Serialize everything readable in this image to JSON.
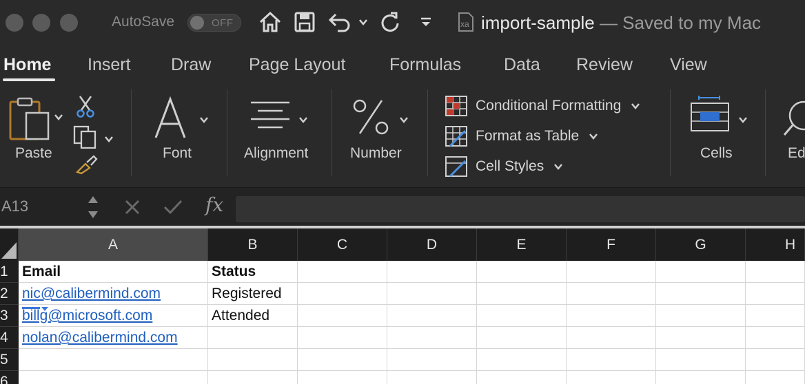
{
  "titlebar": {
    "autosave_label": "AutoSave",
    "autosave_state": "OFF",
    "doc_name": "import-sample",
    "doc_separator": " — ",
    "doc_status": "Saved to my Mac"
  },
  "tabs": [
    {
      "label": "Home",
      "active": true
    },
    {
      "label": "Insert"
    },
    {
      "label": "Draw"
    },
    {
      "label": "Page Layout"
    },
    {
      "label": "Formulas"
    },
    {
      "label": "Data"
    },
    {
      "label": "Review"
    },
    {
      "label": "View"
    }
  ],
  "ribbon": {
    "paste": "Paste",
    "font": "Font",
    "alignment": "Alignment",
    "number": "Number",
    "conditional_formatting": "Conditional Formatting",
    "format_as_table": "Format as Table",
    "cell_styles": "Cell Styles",
    "cells": "Cells",
    "editing": "Ed"
  },
  "formula_bar": {
    "name_box": "A13",
    "fx": "fx",
    "value": ""
  },
  "grid": {
    "columns": [
      "A",
      "B",
      "C",
      "D",
      "E",
      "F",
      "G",
      "H"
    ],
    "selected_column": "A",
    "rows": [
      {
        "num": "1",
        "a": "Email",
        "b": "Status"
      },
      {
        "num": "2",
        "a": "nic@calibermind.com",
        "b": "Registered"
      },
      {
        "num": "3",
        "a": "billg@microsoft.com",
        "b": "Attended"
      },
      {
        "num": "4",
        "a": "nolan@calibermind.com",
        "b": ""
      },
      {
        "num": "5",
        "a": "",
        "b": ""
      },
      {
        "num": "6",
        "a": "",
        "b": ""
      }
    ]
  },
  "colors": {
    "chrome_bg": "#2a2a2a",
    "header_bg": "#1e1e1e",
    "link": "#1f5fbf",
    "accent_red": "#c0392b",
    "accent_blue": "#2e6fd0"
  }
}
